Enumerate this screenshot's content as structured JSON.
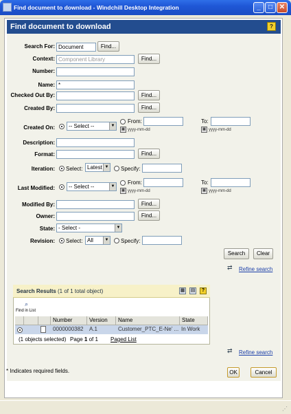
{
  "window": {
    "title": "Find document to download - Windchill Desktop Integration"
  },
  "header": {
    "title": "Find document to download",
    "help": "?"
  },
  "form": {
    "search_for": {
      "label": "Search For:",
      "value": "Document",
      "find": "Find..."
    },
    "context": {
      "label": "Context:",
      "placeholder": "Component Library",
      "find": "Find..."
    },
    "number": {
      "label": "Number:",
      "value": ""
    },
    "name": {
      "label": "Name:",
      "value": "*"
    },
    "checked_out_by": {
      "label": "Checked Out By:",
      "value": "",
      "find": "Find..."
    },
    "created_by": {
      "label": "Created By:",
      "value": "",
      "find": "Find..."
    },
    "created_on": {
      "label": "Created On:",
      "select": "-- Select --",
      "from": "From:",
      "to": "To:",
      "format": "yyyy-mm-dd"
    },
    "description": {
      "label": "Description:",
      "value": ""
    },
    "format": {
      "label": "Format:",
      "value": "",
      "find": "Find..."
    },
    "iteration": {
      "label": "Iteration:",
      "select_lbl": "Select:",
      "select_val": "Latest",
      "specify_lbl": "Specify:"
    },
    "last_modified": {
      "label": "Last Modified:",
      "select": "-- Select --",
      "from": "From:",
      "to": "To:",
      "format": "yyyy-mm-dd"
    },
    "modified_by": {
      "label": "Modified By:",
      "value": "",
      "find": "Find..."
    },
    "owner": {
      "label": "Owner:",
      "value": "",
      "find": "Find..."
    },
    "state": {
      "label": "State:",
      "select": "- Select -"
    },
    "revision": {
      "label": "Revision:",
      "select_lbl": "Select:",
      "select_val": "All",
      "specify_lbl": "Specify:"
    }
  },
  "actions": {
    "search": "Search",
    "clear": "Clear",
    "refine": "Refine search"
  },
  "results": {
    "title": "Search Results",
    "count": "(1 of 1 total object)",
    "find_in_list": "Find in List",
    "columns": [
      "Number",
      "Version",
      "Name",
      "State"
    ],
    "rows": [
      {
        "number": "0000000382",
        "version": "A.1",
        "name": "Customer_PTC_E-Ne’ ...",
        "state": "In Work"
      }
    ],
    "footer_selected": "(1 objects selected)",
    "footer_page_pre": "Page ",
    "footer_page_num": "1",
    "footer_page_post": " of 1",
    "paged_list": "Paged List"
  },
  "footer": {
    "required_note": "Indicates required fields.",
    "asterisk": "*",
    "ok": "OK",
    "cancel": "Cancel"
  },
  "icons": [
    "app-icon",
    "minimize-icon",
    "maximize-icon",
    "close-icon",
    "calendar-icon",
    "refine-search-icon",
    "find-in-list-icon",
    "document-icon"
  ]
}
